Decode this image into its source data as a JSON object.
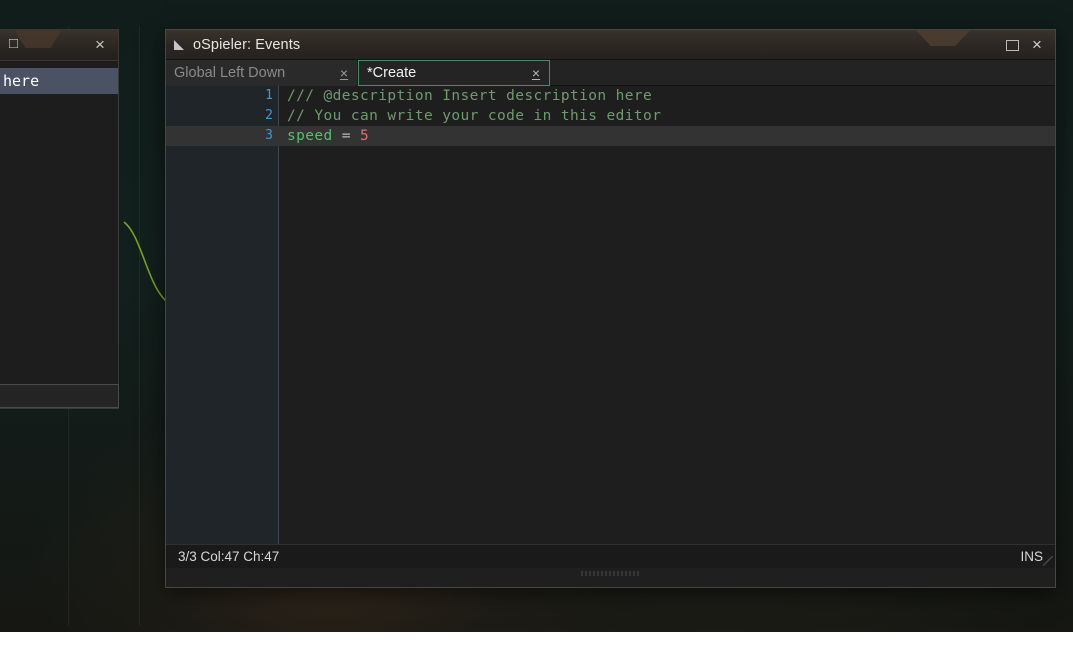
{
  "window": {
    "title": "oSpieler: Events",
    "title_icon": "resize-triangle-icon",
    "maximize_label": "",
    "close_label": "×"
  },
  "tabs": [
    {
      "label": "Global Left Down",
      "close": "×",
      "active": false
    },
    {
      "label": "*Create",
      "close": "×",
      "active": true
    }
  ],
  "editor": {
    "lines": [
      {
        "number": "1",
        "segments": [
          {
            "text": "/// @description Insert description here",
            "cls": "cmt"
          }
        ],
        "current": false
      },
      {
        "number": "2",
        "segments": [
          {
            "text": "// You can write your code in this editor",
            "cls": "cmt"
          }
        ],
        "current": false
      },
      {
        "number": "3",
        "segments": [
          {
            "text": "speed",
            "cls": "kw"
          },
          {
            "text": " = ",
            "cls": "op"
          },
          {
            "text": "5",
            "cls": "num"
          }
        ],
        "current": true
      }
    ],
    "cursor_marker": "›"
  },
  "statusbar": {
    "position": "3/3 Col:47 Ch:47",
    "mode": "INS"
  },
  "left_window": {
    "title_icon": "window-icon",
    "close": "×",
    "list_items": [
      {
        "label": "here",
        "selected": true
      }
    ]
  },
  "colors": {
    "accent_green": "#4a8c6a",
    "cursor_green": "#35c46a",
    "comment_green": "#6f9a6f",
    "keyword_green": "#57c06a",
    "number_red": "#e06c6c",
    "linenumber_blue": "#3f9ad6",
    "selection_blue": "#4a5263",
    "titlebar_brown": "#2d2823",
    "editor_bg": "#1e1e1e"
  }
}
